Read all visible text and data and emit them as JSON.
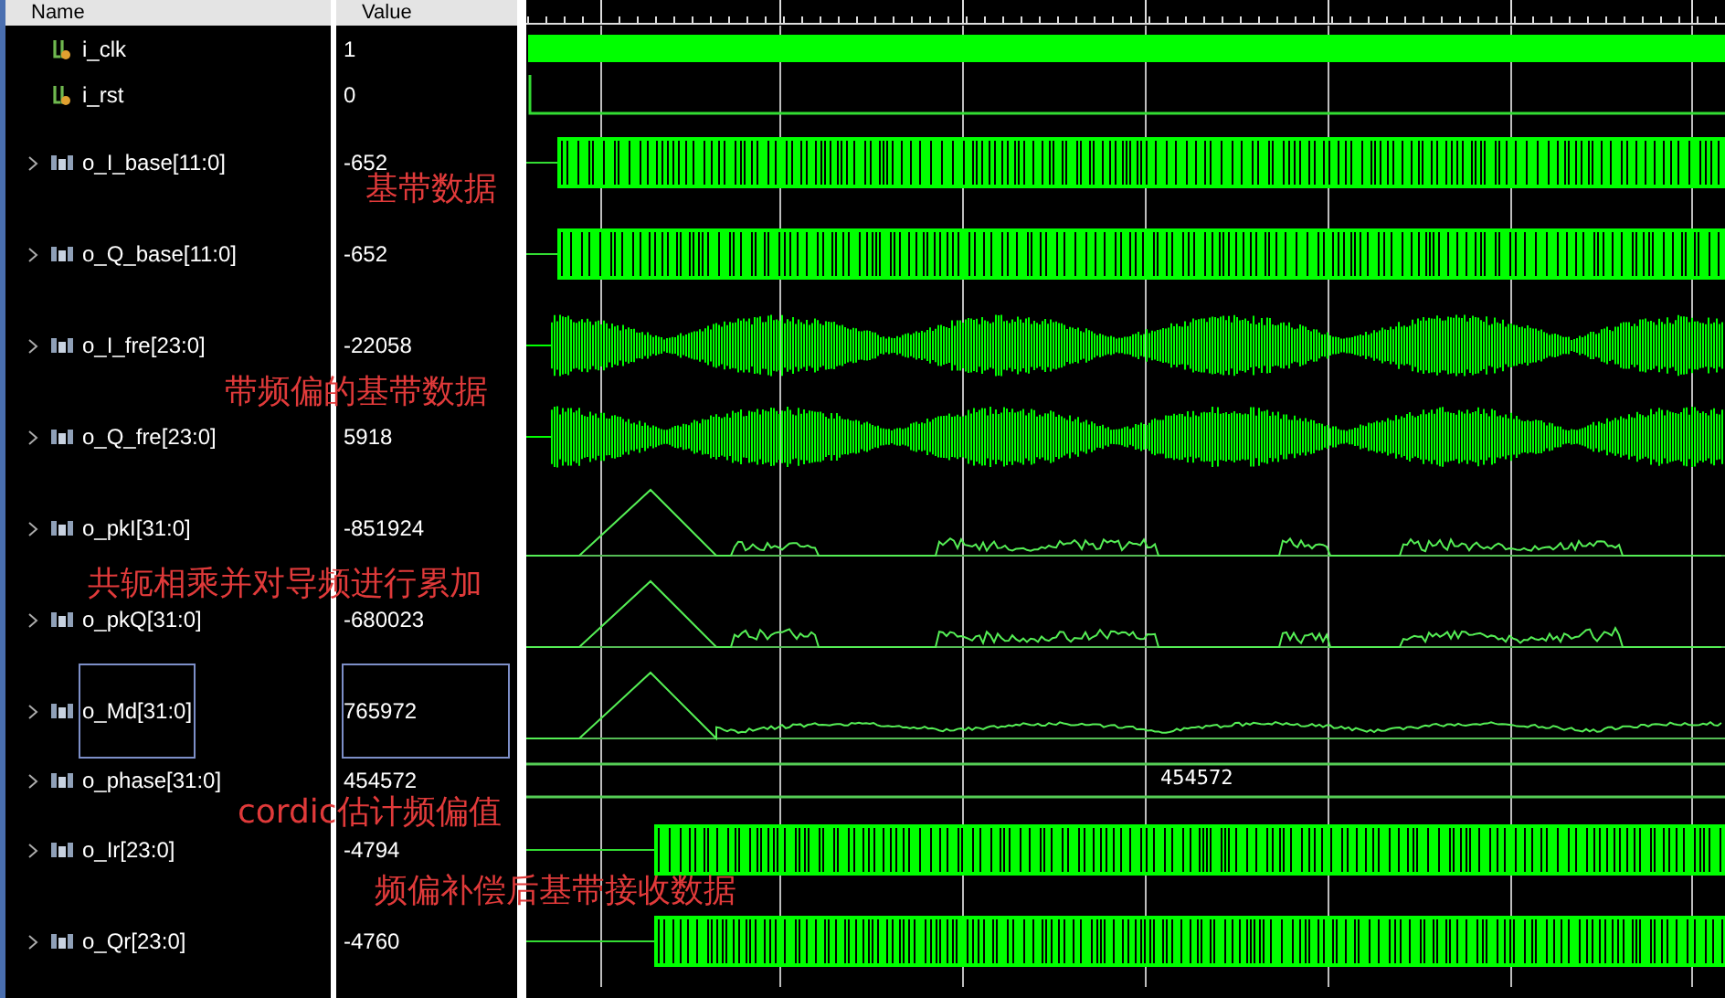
{
  "columns": {
    "name": "Name",
    "value": "Value"
  },
  "signals": [
    {
      "name": "i_clk",
      "value": "1",
      "kind": "clock",
      "selected": false
    },
    {
      "name": "i_rst",
      "value": "0",
      "kind": "low",
      "selected": false
    },
    {
      "name": "o_I_base[11:0]",
      "value": "-652",
      "kind": "digital",
      "selected": false
    },
    {
      "name": "o_Q_base[11:0]",
      "value": "-652",
      "kind": "digital",
      "selected": false
    },
    {
      "name": "o_I_fre[23:0]",
      "value": "-22058",
      "kind": "envelope",
      "selected": false
    },
    {
      "name": "o_Q_fre[23:0]",
      "value": "5918",
      "kind": "envelope",
      "selected": false
    },
    {
      "name": "o_pkI[31:0]",
      "value": "-851924",
      "kind": "burst",
      "selected": false
    },
    {
      "name": "o_pkQ[31:0]",
      "value": "-680023",
      "kind": "burst",
      "selected": false
    },
    {
      "name": "o_Md[31:0]",
      "value": "765972",
      "kind": "analog",
      "selected": true
    },
    {
      "name": "o_phase[31:0]",
      "value": "454572",
      "kind": "value",
      "wave_label": "454572",
      "selected": false
    },
    {
      "name": "o_Ir[23:0]",
      "value": "-4794",
      "kind": "late",
      "selected": false
    },
    {
      "name": "o_Qr[23:0]",
      "value": "-4760",
      "kind": "late",
      "selected": false
    }
  ],
  "annotations": [
    "基带数据",
    "带频偏的基带数据",
    "共轭相乘并对导频进行累加",
    "cordic估计频偏值",
    "频偏补偿后基带接收数据"
  ]
}
